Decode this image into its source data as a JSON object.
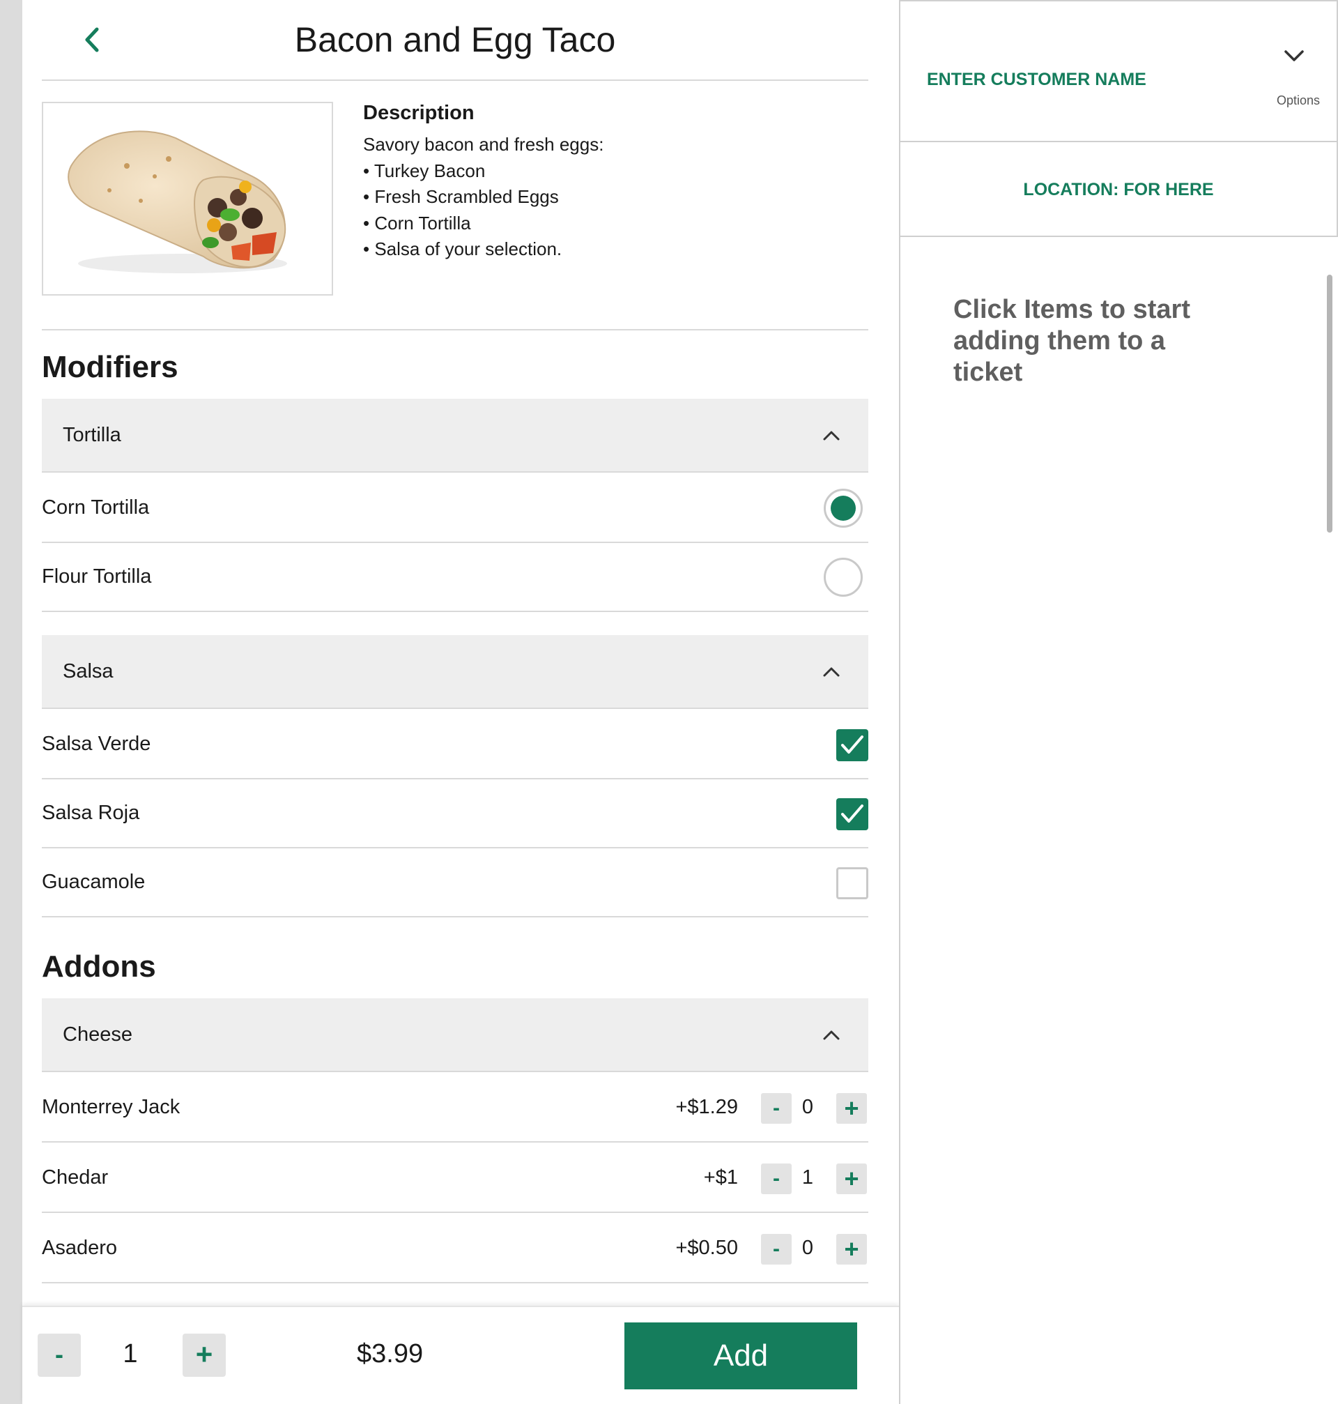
{
  "item": {
    "title": "Bacon and Egg Taco",
    "image_alt": "Bacon and egg taco wrapped in tortilla",
    "description": {
      "heading": "Description",
      "lines": [
        "Savory bacon and fresh eggs:",
        "• Turkey Bacon",
        "• Fresh Scrambled Eggs",
        "• Corn Tortilla",
        "• Salsa of your selection."
      ]
    }
  },
  "modifiers": {
    "heading": "Modifiers",
    "groups": [
      {
        "name": "Tortilla",
        "type": "radio",
        "options": [
          {
            "label": "Corn Tortilla",
            "selected": true
          },
          {
            "label": "Flour Tortilla",
            "selected": false
          }
        ]
      },
      {
        "name": "Salsa",
        "type": "checkbox",
        "options": [
          {
            "label": "Salsa Verde",
            "checked": true
          },
          {
            "label": "Salsa Roja",
            "checked": true
          },
          {
            "label": "Guacamole",
            "checked": false
          }
        ]
      }
    ]
  },
  "addons": {
    "heading": "Addons",
    "groups": [
      {
        "name": "Cheese",
        "items": [
          {
            "label": "Monterrey Jack",
            "price": "+$1.29",
            "qty": "0"
          },
          {
            "label": "Chedar",
            "price": "+$1",
            "qty": "1"
          },
          {
            "label": "Asadero",
            "price": "+$0.50",
            "qty": "0"
          }
        ]
      }
    ]
  },
  "footer": {
    "minus": "-",
    "plus": "+",
    "quantity": "1",
    "total": "$3.99",
    "add_label": "Add"
  },
  "stepper": {
    "minus": "-",
    "plus": "+"
  },
  "ticket": {
    "customer_name_label": "ENTER CUSTOMER NAME",
    "options_label": "Options",
    "location_label": "LOCATION: FOR HERE",
    "empty_message": "Click Items to start adding them to a ticket"
  },
  "colors": {
    "accent": "#157d5c",
    "header_bg": "#eeeeee",
    "divider": "#d9d9d9",
    "muted_text": "#5f5f5f"
  },
  "icons": {
    "back": "chevron-left-icon",
    "collapse": "chevron-up-icon",
    "options": "chevron-down-icon",
    "check": "check-icon"
  }
}
